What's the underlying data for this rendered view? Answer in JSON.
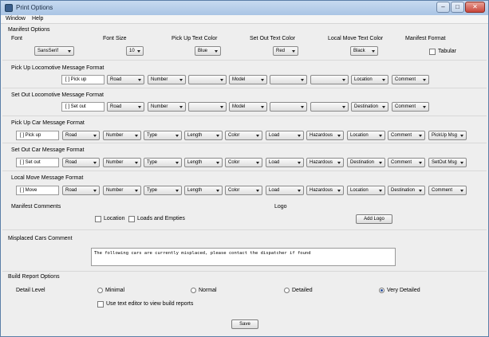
{
  "window": {
    "title": "Print Options",
    "minimize": "–",
    "maximize": "□",
    "close": "✕"
  },
  "menu": [
    "Window",
    "Help"
  ],
  "manifest_options": {
    "heading": "Manifest Options",
    "labels": {
      "font": "Font",
      "font_size": "Font Size",
      "pickup_color": "Pick Up Text Color",
      "setout_color": "Set Out Text Color",
      "local_color": "Local Move Text Color",
      "manifest_format": "Manifest Format"
    },
    "values": {
      "font": "SansSerif",
      "font_size": "10",
      "pickup_color": "Blue",
      "setout_color": "Red",
      "local_color": "Black"
    },
    "tabular": "Tabular"
  },
  "pickup_loco": {
    "heading": "Pick Up Locomotive Message Format",
    "prefix": "[ ] Pick up",
    "fields": [
      "Road",
      "Number",
      "",
      "Model",
      "",
      "",
      "Location",
      "Comment"
    ]
  },
  "setout_loco": {
    "heading": "Set Out Locomotive Message Format",
    "prefix": "[ ] Set out",
    "fields": [
      "Road",
      "Number",
      "",
      "Model",
      "",
      "",
      "Destination",
      "Comment"
    ]
  },
  "pickup_car": {
    "heading": "Pick Up Car Message Format",
    "prefix": "[ ] Pick up",
    "fields": [
      "Road",
      "Number",
      "Type",
      "Length",
      "Color",
      "Load",
      "Hazardous",
      "Location",
      "Comment",
      "PickUp Msg"
    ]
  },
  "setout_car": {
    "heading": "Set Out Car Message Format",
    "prefix": "[ ] Set out",
    "fields": [
      "Road",
      "Number",
      "Type",
      "Length",
      "Color",
      "Load",
      "Hazardous",
      "Destination",
      "Comment",
      "SetOut Msg"
    ]
  },
  "local_move": {
    "heading": "Local Move Message Format",
    "prefix": "[ ] Move",
    "fields": [
      "Road",
      "Number",
      "Type",
      "Length",
      "Color",
      "Load",
      "Hazardous",
      "Location",
      "Destination",
      "Comment"
    ]
  },
  "manifest_comments": {
    "heading": "Manifest Comments",
    "location": "Location",
    "loads_empties": "Loads and Empties"
  },
  "logo": {
    "heading": "Logo",
    "button": "Add Logo"
  },
  "misplaced": {
    "heading": "Misplaced Cars Comment",
    "text": "The following cars are currently misplaced, please contact the dispatcher if found"
  },
  "build_report": {
    "heading": "Build Report Options",
    "detail_level": "Detail Level",
    "options": [
      "Minimal",
      "Normal",
      "Detailed",
      "Very Detailed"
    ],
    "selected": 3,
    "text_editor": "Use text editor to view build reports"
  },
  "save": "Save"
}
